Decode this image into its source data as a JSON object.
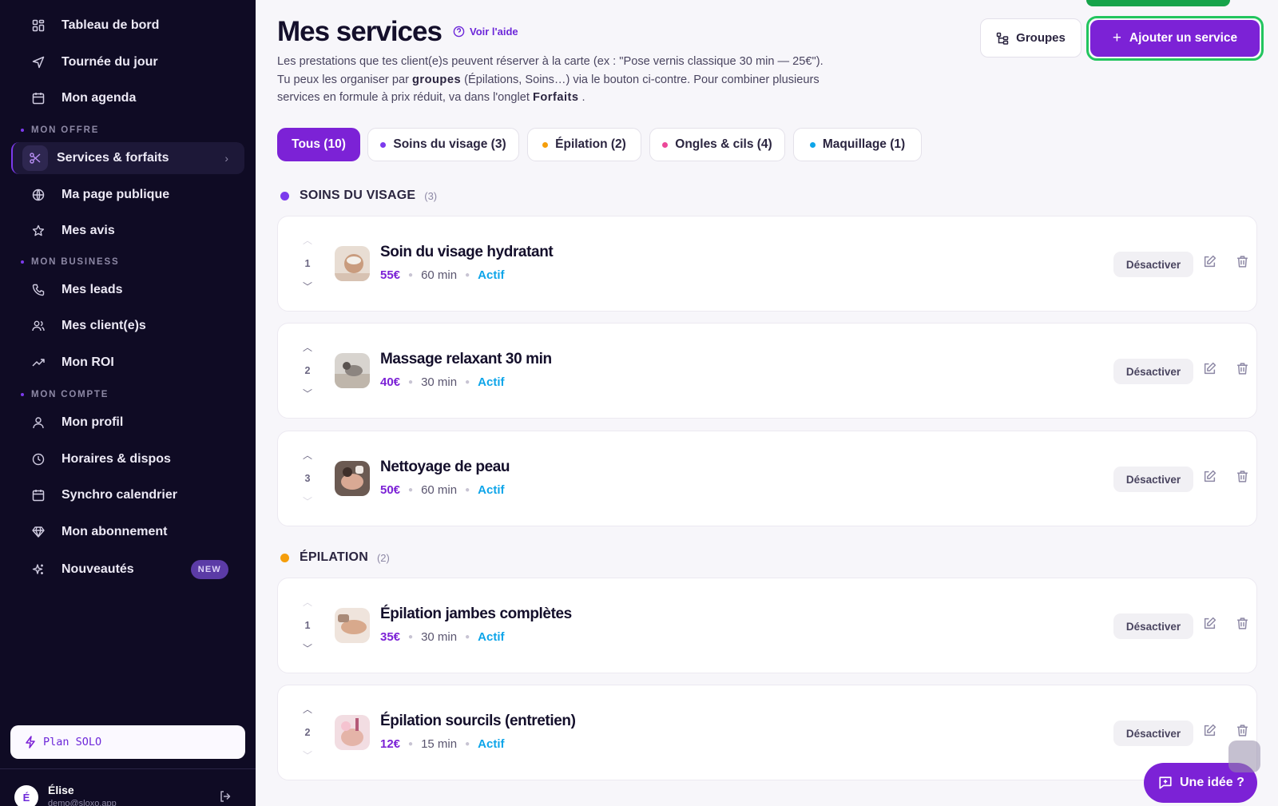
{
  "sidebar": {
    "items": [
      {
        "label": "Tableau de bord",
        "icon": "dashboard-icon"
      },
      {
        "label": "Tournée du jour",
        "icon": "navigation-icon"
      },
      {
        "label": "Mon agenda",
        "icon": "calendar-icon"
      },
      {
        "label": "Services & forfaits",
        "icon": "scissors-icon",
        "active": true
      },
      {
        "label": "Ma page publique",
        "icon": "globe-icon"
      },
      {
        "label": "Mes avis",
        "icon": "star-icon"
      },
      {
        "label": "Mes leads",
        "icon": "phone-icon"
      },
      {
        "label": "Mes client(e)s",
        "icon": "users-icon"
      },
      {
        "label": "Mon ROI",
        "icon": "trending-up-icon"
      },
      {
        "label": "Mon profil",
        "icon": "user-icon"
      },
      {
        "label": "Horaires & dispos",
        "icon": "clock-icon"
      },
      {
        "label": "Synchro calendrier",
        "icon": "calendar-sync-icon"
      },
      {
        "label": "Mon abonnement",
        "icon": "diamond-icon"
      },
      {
        "label": "Nouveautés",
        "icon": "sparkles-icon",
        "badge": "NEW"
      }
    ],
    "sections": {
      "offer": "MON OFFRE",
      "business": "MON BUSINESS",
      "account": "MON COMPTE"
    },
    "plan": "Plan SOLO",
    "user": {
      "initial": "É",
      "name": "Élise",
      "email": "demo@sloxo.app"
    }
  },
  "header": {
    "title": "Mes services",
    "help": "Voir l'aide",
    "desc_1": "Les prestations que tes client(e)s peuvent réserver à la carte (ex : \"Pose vernis classique 30 min — 25€\").",
    "desc_2a": "Tu peux les organiser par ",
    "desc_2b": "groupes",
    "desc_2c": " (Épilations, Soins…) via le bouton ci-contre. Pour combiner plusieurs",
    "desc_3a": "services en formule à prix réduit, va dans l'onglet ",
    "desc_3b": "Forfaits",
    "desc_3c": " .",
    "groups_button": "Groupes",
    "add_button": "Ajouter un service"
  },
  "tabs": [
    {
      "label": "Tous (10)",
      "active": true
    },
    {
      "label": "Soins du visage (3)",
      "color": "#7c3aed"
    },
    {
      "label": "Épilation (2)",
      "color": "#f59e0b"
    },
    {
      "label": "Ongles & cils (4)",
      "color": "#ec4899"
    },
    {
      "label": "Maquillage (1)",
      "color": "#0ea5e9"
    }
  ],
  "groups": [
    {
      "name": "SOINS DU VISAGE",
      "count": "(3)",
      "color": "#7c3aed",
      "services": [
        {
          "order": "1",
          "name": "Soin du visage hydratant",
          "price": "55€",
          "duration": "60 min",
          "status": "Actif"
        },
        {
          "order": "2",
          "name": "Massage relaxant 30 min",
          "price": "40€",
          "duration": "30 min",
          "status": "Actif"
        },
        {
          "order": "3",
          "name": "Nettoyage de peau",
          "price": "50€",
          "duration": "60 min",
          "status": "Actif"
        }
      ]
    },
    {
      "name": "ÉPILATION",
      "count": "(2)",
      "color": "#f59e0b",
      "services": [
        {
          "order": "1",
          "name": "Épilation jambes complètes",
          "price": "35€",
          "duration": "30 min",
          "status": "Actif"
        },
        {
          "order": "2",
          "name": "Épilation sourcils (entretien)",
          "price": "12€",
          "duration": "15 min",
          "status": "Actif"
        }
      ]
    }
  ],
  "actions": {
    "deactivate": "Désactiver"
  },
  "idea_button": "Une idée ?"
}
